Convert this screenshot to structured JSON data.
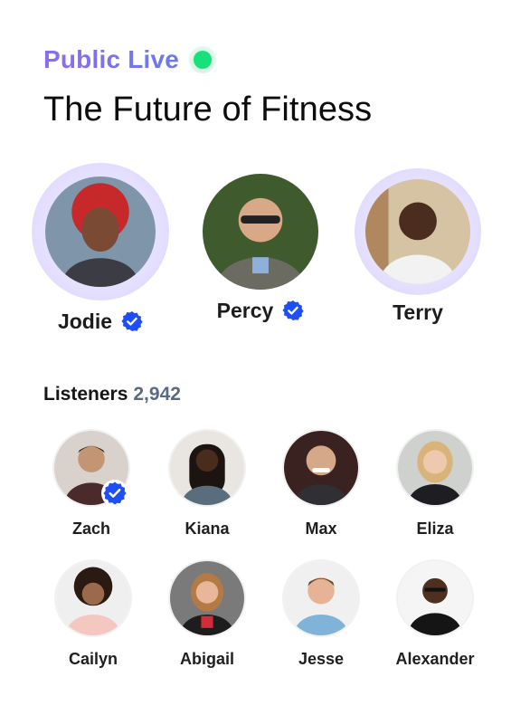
{
  "room": {
    "status_label": "Public Live",
    "title": "The Future of Fitness"
  },
  "colors": {
    "live_dot": "#19e07a",
    "verified_blue": "#1f4ef5",
    "accent_purple": "#8b6cf0",
    "count_gray": "#5a6a86"
  },
  "speakers": [
    {
      "name": "Jodie",
      "verified": true,
      "speaking": true
    },
    {
      "name": "Percy",
      "verified": true,
      "speaking": false
    },
    {
      "name": "Terry",
      "verified": false,
      "speaking": true
    }
  ],
  "listeners": {
    "label": "Listeners",
    "count": "2,942",
    "people": [
      {
        "name": "Zach",
        "verified": true
      },
      {
        "name": "Kiana",
        "verified": false
      },
      {
        "name": "Max",
        "verified": false
      },
      {
        "name": "Eliza",
        "verified": false
      },
      {
        "name": "Cailyn",
        "verified": false
      },
      {
        "name": "Abigail",
        "verified": false
      },
      {
        "name": "Jesse",
        "verified": false
      },
      {
        "name": "Alexander",
        "verified": false
      }
    ]
  }
}
